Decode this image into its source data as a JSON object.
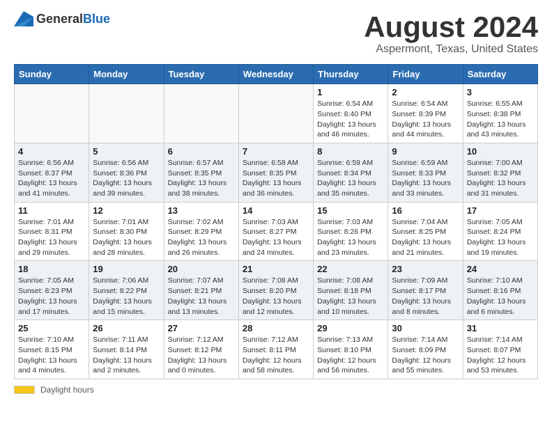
{
  "logo": {
    "general": "General",
    "blue": "Blue"
  },
  "title": "August 2024",
  "subtitle": "Aspermont, Texas, United States",
  "days_of_week": [
    "Sunday",
    "Monday",
    "Tuesday",
    "Wednesday",
    "Thursday",
    "Friday",
    "Saturday"
  ],
  "footer": {
    "daylight_label": "Daylight hours"
  },
  "weeks": [
    [
      {
        "day": "",
        "info": ""
      },
      {
        "day": "",
        "info": ""
      },
      {
        "day": "",
        "info": ""
      },
      {
        "day": "",
        "info": ""
      },
      {
        "day": "1",
        "info": "Sunrise: 6:54 AM\nSunset: 8:40 PM\nDaylight: 13 hours and 46 minutes."
      },
      {
        "day": "2",
        "info": "Sunrise: 6:54 AM\nSunset: 8:39 PM\nDaylight: 13 hours and 44 minutes."
      },
      {
        "day": "3",
        "info": "Sunrise: 6:55 AM\nSunset: 8:38 PM\nDaylight: 13 hours and 43 minutes."
      }
    ],
    [
      {
        "day": "4",
        "info": "Sunrise: 6:56 AM\nSunset: 8:37 PM\nDaylight: 13 hours and 41 minutes."
      },
      {
        "day": "5",
        "info": "Sunrise: 6:56 AM\nSunset: 8:36 PM\nDaylight: 13 hours and 39 minutes."
      },
      {
        "day": "6",
        "info": "Sunrise: 6:57 AM\nSunset: 8:35 PM\nDaylight: 13 hours and 38 minutes."
      },
      {
        "day": "7",
        "info": "Sunrise: 6:58 AM\nSunset: 8:35 PM\nDaylight: 13 hours and 36 minutes."
      },
      {
        "day": "8",
        "info": "Sunrise: 6:59 AM\nSunset: 8:34 PM\nDaylight: 13 hours and 35 minutes."
      },
      {
        "day": "9",
        "info": "Sunrise: 6:59 AM\nSunset: 8:33 PM\nDaylight: 13 hours and 33 minutes."
      },
      {
        "day": "10",
        "info": "Sunrise: 7:00 AM\nSunset: 8:32 PM\nDaylight: 13 hours and 31 minutes."
      }
    ],
    [
      {
        "day": "11",
        "info": "Sunrise: 7:01 AM\nSunset: 8:31 PM\nDaylight: 13 hours and 29 minutes."
      },
      {
        "day": "12",
        "info": "Sunrise: 7:01 AM\nSunset: 8:30 PM\nDaylight: 13 hours and 28 minutes."
      },
      {
        "day": "13",
        "info": "Sunrise: 7:02 AM\nSunset: 8:29 PM\nDaylight: 13 hours and 26 minutes."
      },
      {
        "day": "14",
        "info": "Sunrise: 7:03 AM\nSunset: 8:27 PM\nDaylight: 13 hours and 24 minutes."
      },
      {
        "day": "15",
        "info": "Sunrise: 7:03 AM\nSunset: 8:26 PM\nDaylight: 13 hours and 23 minutes."
      },
      {
        "day": "16",
        "info": "Sunrise: 7:04 AM\nSunset: 8:25 PM\nDaylight: 13 hours and 21 minutes."
      },
      {
        "day": "17",
        "info": "Sunrise: 7:05 AM\nSunset: 8:24 PM\nDaylight: 13 hours and 19 minutes."
      }
    ],
    [
      {
        "day": "18",
        "info": "Sunrise: 7:05 AM\nSunset: 8:23 PM\nDaylight: 13 hours and 17 minutes."
      },
      {
        "day": "19",
        "info": "Sunrise: 7:06 AM\nSunset: 8:22 PM\nDaylight: 13 hours and 15 minutes."
      },
      {
        "day": "20",
        "info": "Sunrise: 7:07 AM\nSunset: 8:21 PM\nDaylight: 13 hours and 13 minutes."
      },
      {
        "day": "21",
        "info": "Sunrise: 7:08 AM\nSunset: 8:20 PM\nDaylight: 13 hours and 12 minutes."
      },
      {
        "day": "22",
        "info": "Sunrise: 7:08 AM\nSunset: 8:18 PM\nDaylight: 13 hours and 10 minutes."
      },
      {
        "day": "23",
        "info": "Sunrise: 7:09 AM\nSunset: 8:17 PM\nDaylight: 13 hours and 8 minutes."
      },
      {
        "day": "24",
        "info": "Sunrise: 7:10 AM\nSunset: 8:16 PM\nDaylight: 13 hours and 6 minutes."
      }
    ],
    [
      {
        "day": "25",
        "info": "Sunrise: 7:10 AM\nSunset: 8:15 PM\nDaylight: 13 hours and 4 minutes."
      },
      {
        "day": "26",
        "info": "Sunrise: 7:11 AM\nSunset: 8:14 PM\nDaylight: 13 hours and 2 minutes."
      },
      {
        "day": "27",
        "info": "Sunrise: 7:12 AM\nSunset: 8:12 PM\nDaylight: 13 hours and 0 minutes."
      },
      {
        "day": "28",
        "info": "Sunrise: 7:12 AM\nSunset: 8:11 PM\nDaylight: 12 hours and 58 minutes."
      },
      {
        "day": "29",
        "info": "Sunrise: 7:13 AM\nSunset: 8:10 PM\nDaylight: 12 hours and 56 minutes."
      },
      {
        "day": "30",
        "info": "Sunrise: 7:14 AM\nSunset: 8:09 PM\nDaylight: 12 hours and 55 minutes."
      },
      {
        "day": "31",
        "info": "Sunrise: 7:14 AM\nSunset: 8:07 PM\nDaylight: 12 hours and 53 minutes."
      }
    ]
  ]
}
